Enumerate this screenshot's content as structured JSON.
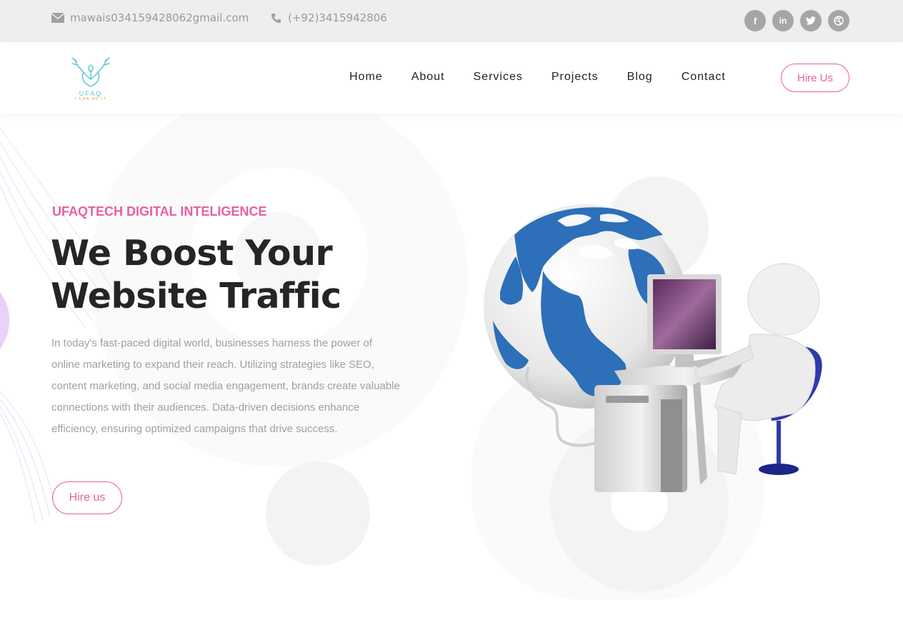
{
  "topbar": {
    "email": "mawais034159428062gmail.com",
    "phone": "(+92)3415942806",
    "socials": [
      {
        "icon": "facebook-icon",
        "glyph": "f"
      },
      {
        "icon": "linkedin-icon",
        "glyph": "in"
      },
      {
        "icon": "twitter-icon",
        "glyph": "🐦"
      },
      {
        "icon": "dribbble-icon",
        "glyph": "◎"
      }
    ]
  },
  "logo": {
    "name": "UFAQ",
    "tagline": "I CAN DO IT"
  },
  "nav": {
    "items": [
      "Home",
      "About",
      "Services",
      "Projects",
      "Blog",
      "Contact"
    ],
    "hire_label": "Hire Us"
  },
  "hero": {
    "eyebrow": "UFAQTECH DIGITAL INTELIGENCE",
    "headline_line1": "We Boost Your",
    "headline_line2": "Website Traffic",
    "paragraph": "In today's fast-paced digital world, businesses harness the power of online marketing to expand their reach. Utilizing strategies like SEO, content marketing, and social media engagement, brands create valuable connections with their audiences. Data-driven decisions enhance efficiency, ensuring optimized campaigns that drive success.",
    "cta_label": "Hire us"
  },
  "colors": {
    "accent": "#e8609f",
    "globe": "#2d6fb8",
    "topbar_bg": "#eeeeee"
  }
}
